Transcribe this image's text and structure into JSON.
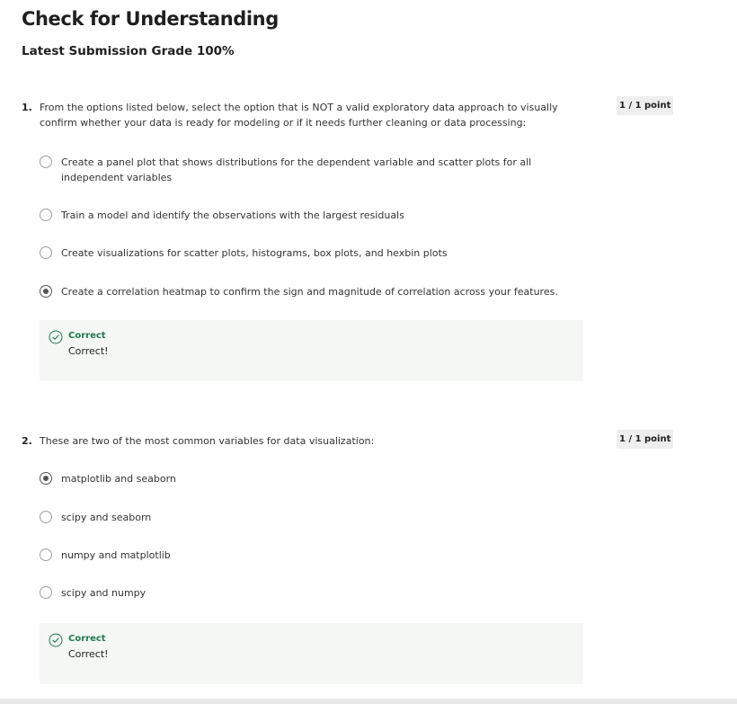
{
  "header": {
    "title": "Check for Understanding",
    "grade_line": "Latest Submission Grade 100%"
  },
  "colors": {
    "correct_green": "#1f7a4c",
    "feedback_bg": "#f5f7f5",
    "badge_bg": "#eeeeee"
  },
  "questions": [
    {
      "number": "1.",
      "prompt": "From the options listed below, select the option that is NOT a valid exploratory data approach to visually confirm whether your data is ready for modeling or if it needs further cleaning or data processing:",
      "points": "1 / 1 point",
      "options": [
        {
          "label": "Create a panel plot that shows distributions for the dependent variable and scatter plots for all independent variables",
          "selected": false
        },
        {
          "label": "Train a model and identify the observations with the largest residuals",
          "selected": false
        },
        {
          "label": "Create visualizations for scatter plots, histograms, box plots, and hexbin plots",
          "selected": false
        },
        {
          "label": "Create a correlation heatmap to confirm the sign and magnitude of correlation across your features.",
          "selected": true
        }
      ],
      "feedback": {
        "icon": "check-circle-icon",
        "status": "Correct",
        "text": "Correct!"
      }
    },
    {
      "number": "2.",
      "prompt": "These are two of the most common variables for data visualization:",
      "points": "1 / 1 point",
      "options": [
        {
          "label": "matplotlib and seaborn",
          "selected": true
        },
        {
          "label": "scipy and seaborn",
          "selected": false
        },
        {
          "label": "numpy and matplotlib",
          "selected": false
        },
        {
          "label": "scipy and numpy",
          "selected": false
        }
      ],
      "feedback": {
        "icon": "check-circle-icon",
        "status": "Correct",
        "text": "Correct!"
      }
    }
  ]
}
